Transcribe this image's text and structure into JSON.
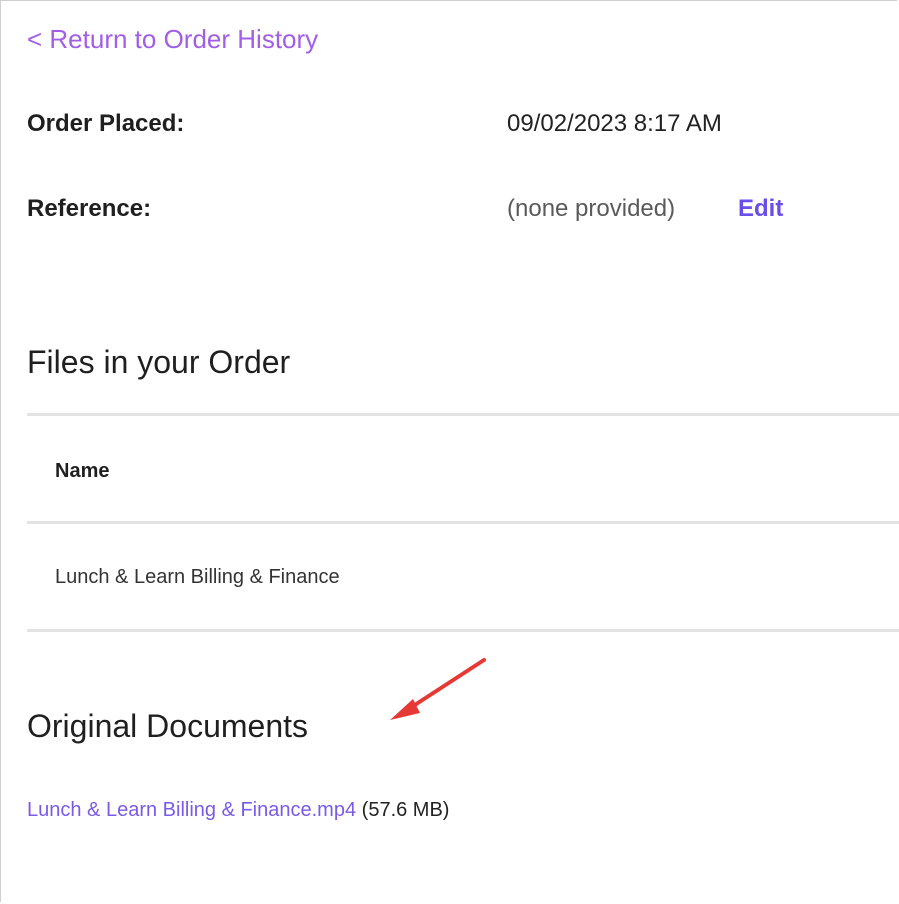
{
  "back_link": "< Return to Order History",
  "order_details": [
    {
      "label": "Order Placed:",
      "value": "09/02/2023 8:17 AM"
    },
    {
      "label": "Reference:",
      "value": "(none provided)",
      "action": "Edit"
    }
  ],
  "files_section": {
    "title": "Files in your Order",
    "columns": [
      "Name"
    ],
    "rows": [
      [
        "Lunch & Learn Billing & Finance"
      ]
    ]
  },
  "original_documents": {
    "title": "Original Documents",
    "items": [
      {
        "filename": "Lunch & Learn Billing & Finance.mp4",
        "size": "(57.6 MB)"
      }
    ]
  },
  "colors": {
    "link": "#a25ee6",
    "edit": "#6a4ee8",
    "annotation_arrow": "#e53935"
  }
}
